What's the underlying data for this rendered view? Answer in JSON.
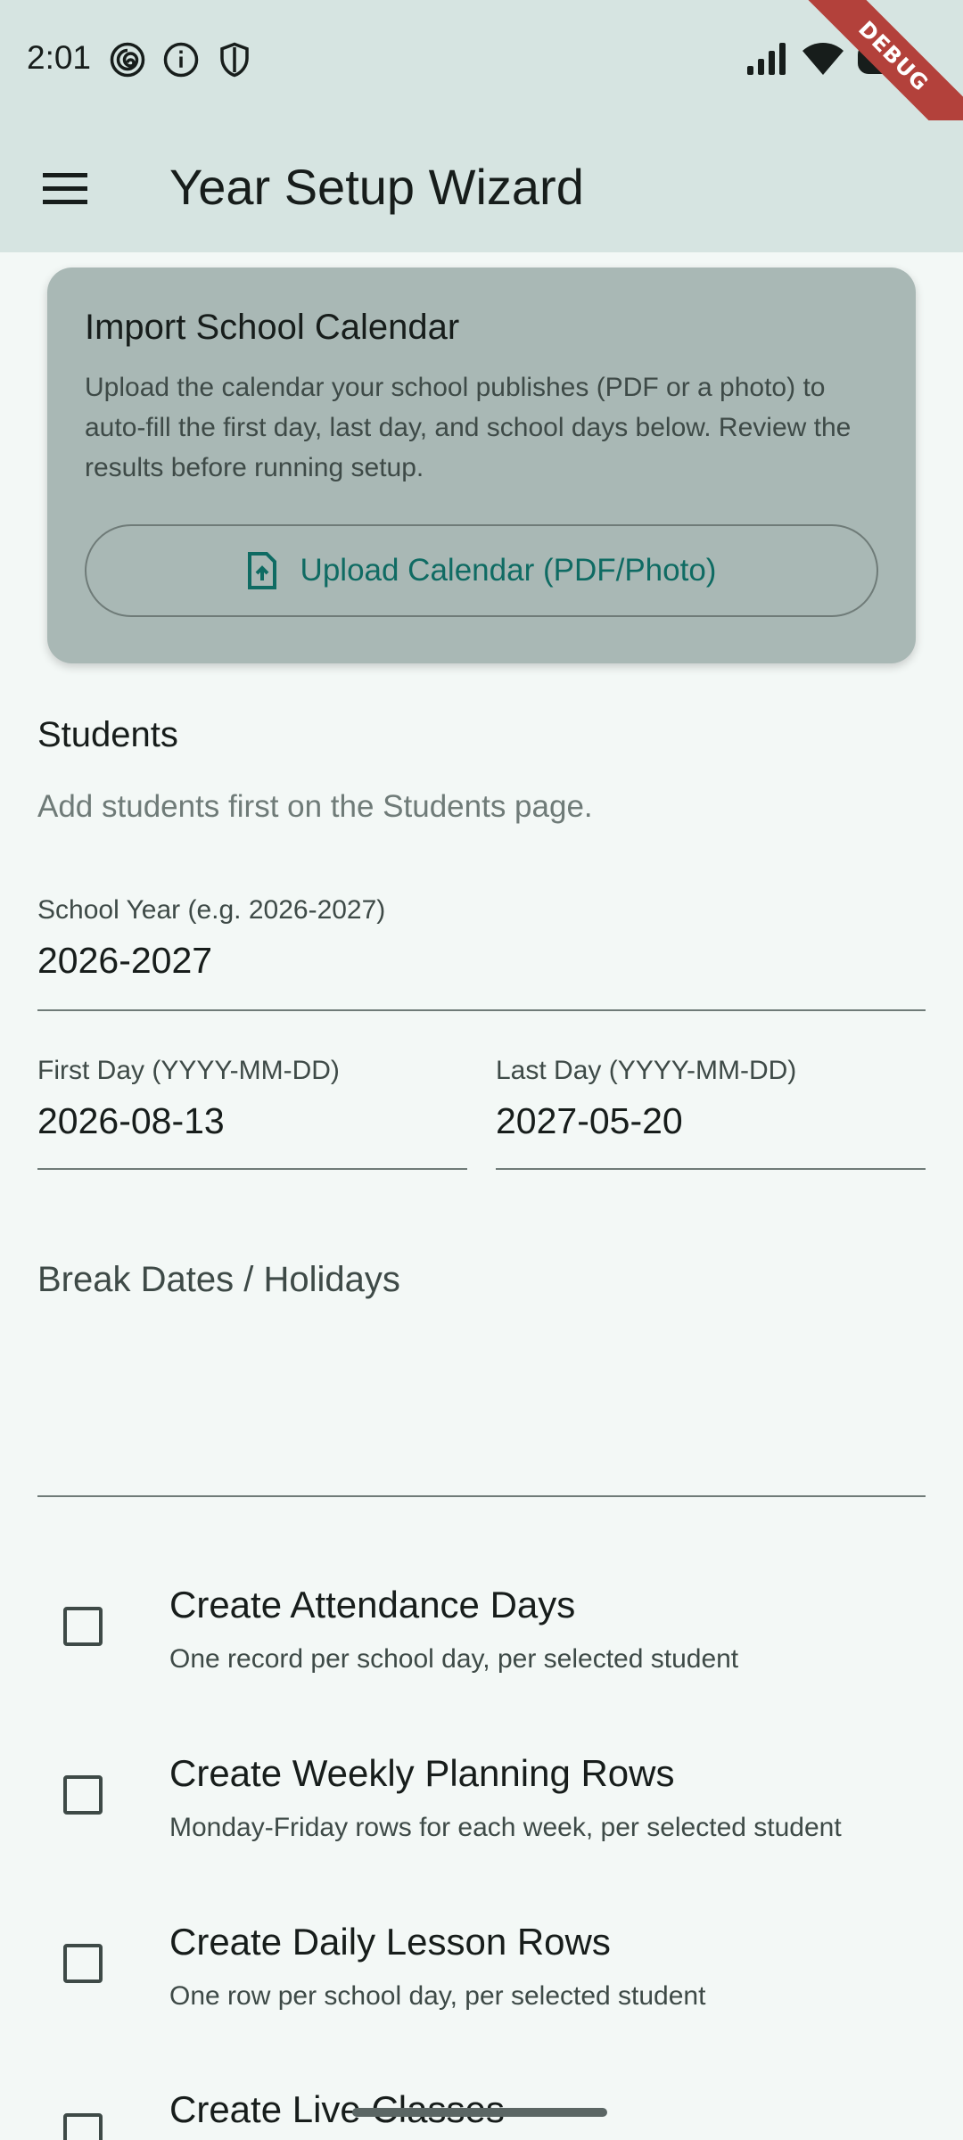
{
  "status_bar": {
    "time": "2:01",
    "debug_label": "DEBUG"
  },
  "app_bar": {
    "title": "Year Setup Wizard",
    "menu_icon": "hamburger-menu-icon"
  },
  "import_card": {
    "title": "Import School Calendar",
    "description": "Upload the calendar your school publishes (PDF or a photo) to auto-fill the first day, last day, and school days below. Review the results before running setup.",
    "upload_label": "Upload Calendar (PDF/Photo)",
    "upload_icon": "file-upload-icon",
    "accent_color": "#0f6b63"
  },
  "students": {
    "title": "Students",
    "hint": "Add students first on the Students page."
  },
  "fields": {
    "school_year": {
      "label": "School Year (e.g. 2026-2027)",
      "value": "2026-2027"
    },
    "first_day": {
      "label": "First Day (YYYY-MM-DD)",
      "value": "2026-08-13"
    },
    "last_day": {
      "label": "Last Day (YYYY-MM-DD)",
      "value": "2027-05-20"
    },
    "breaks": {
      "placeholder": "Break Dates / Holidays",
      "value": ""
    }
  },
  "options": [
    {
      "title": "Create Attendance Days",
      "subtitle": "One record per school day, per selected student",
      "checked": false
    },
    {
      "title": "Create Weekly Planning Rows",
      "subtitle": "Monday-Friday rows for each week, per selected student",
      "checked": false
    },
    {
      "title": "Create Daily Lesson Rows",
      "subtitle": "One row per school day, per selected student",
      "checked": false
    },
    {
      "title": "Create Live Classes",
      "subtitle": "",
      "checked": false
    }
  ]
}
